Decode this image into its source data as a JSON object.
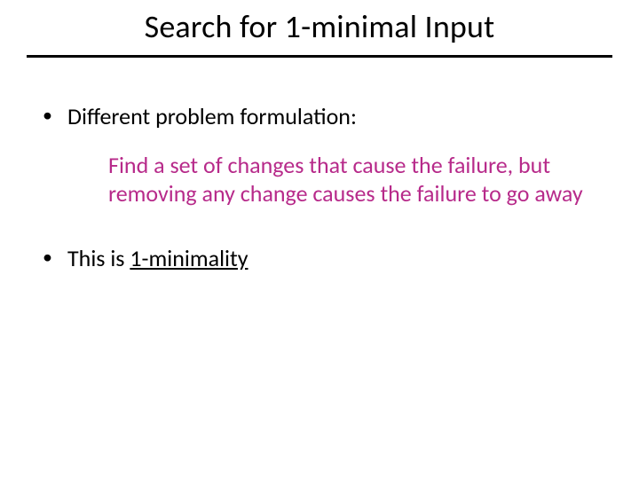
{
  "title": "Search for 1-minimal Input",
  "bullets": {
    "b1": "Different problem formulation:",
    "b1_sub": "Find a set of changes that cause the failure, but removing any change causes the failure to go away",
    "b2_prefix": "This is ",
    "b2_term": "1-minimality"
  }
}
